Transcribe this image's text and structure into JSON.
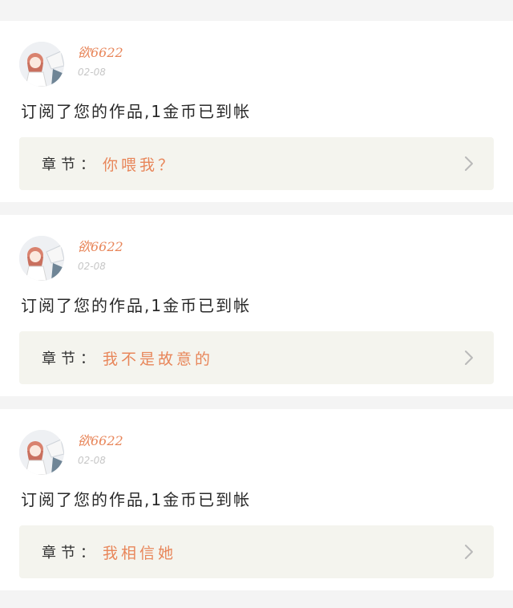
{
  "notifications": [
    {
      "user": "欲6622",
      "date": "02-08",
      "message": "订阅了您的作品,1金币已到帐",
      "chapter_label": "章节：",
      "chapter_title": "你喂我？"
    },
    {
      "user": "欲6622",
      "date": "02-08",
      "message": "订阅了您的作品,1金币已到帐",
      "chapter_label": "章节：",
      "chapter_title": "我不是故意的"
    },
    {
      "user": "欲6622",
      "date": "02-08",
      "message": "订阅了您的作品,1金币已到帐",
      "chapter_label": "章节：",
      "chapter_title": "我相信她"
    }
  ],
  "icons": {
    "avatar": "anime-girl-avatar",
    "chevron": "chevron-right-icon"
  },
  "colors": {
    "accent": "#e8865a",
    "chapter_bg": "#f4f4ee",
    "page_bg": "#f4f4f4"
  }
}
